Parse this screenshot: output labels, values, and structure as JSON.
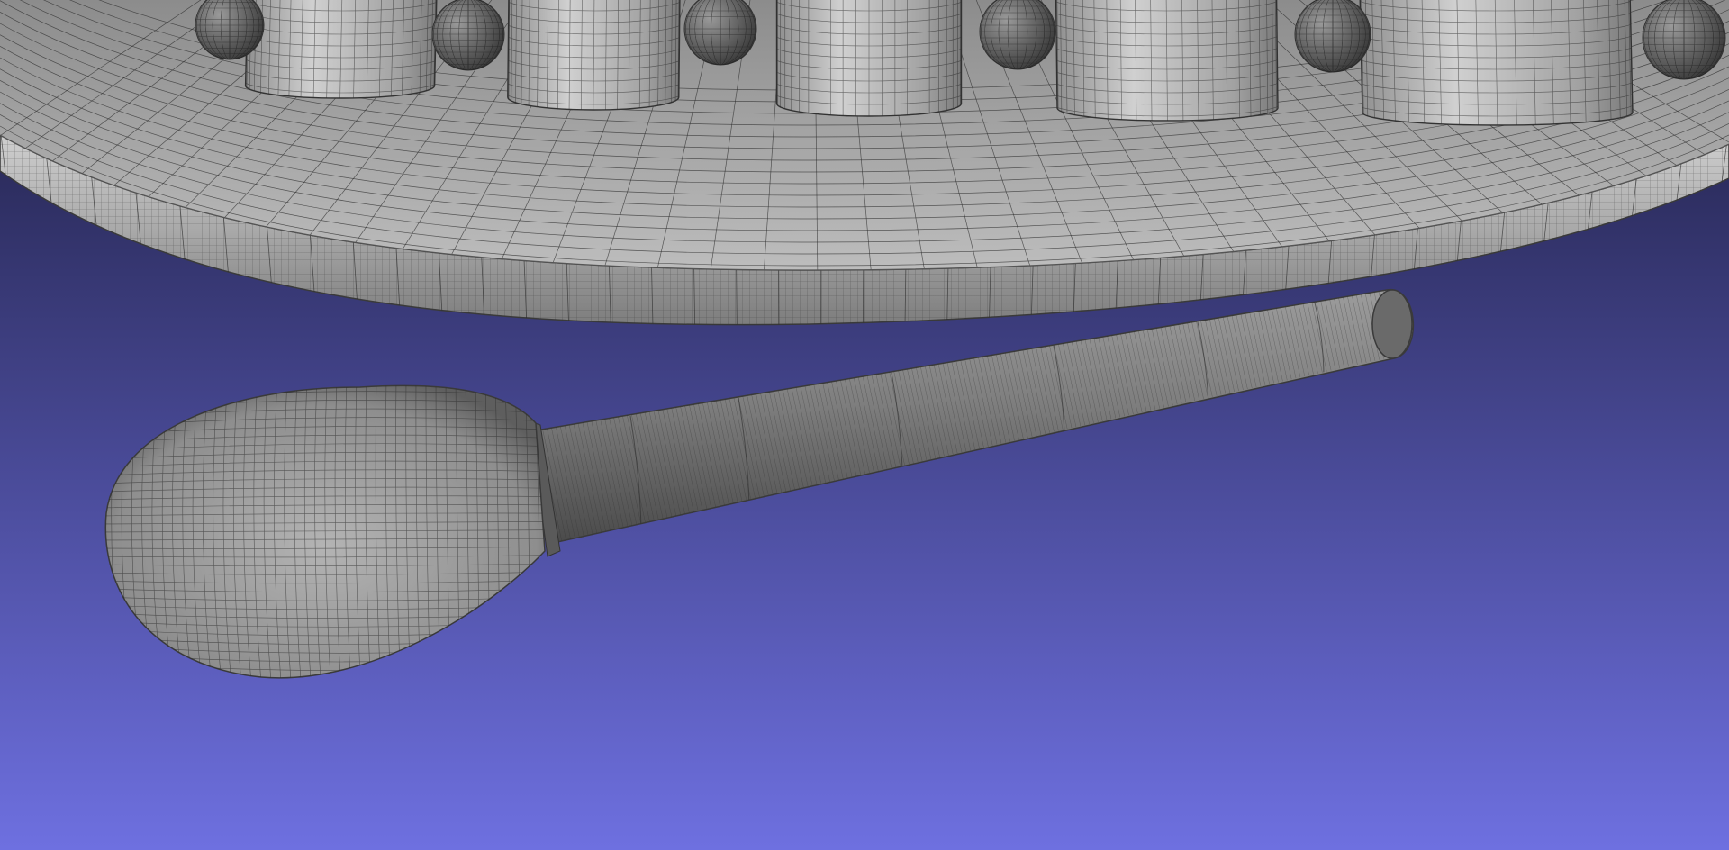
{
  "viewer": {
    "background_top_color": "#1c1c3e",
    "background_bottom_color": "#6e70e0",
    "mesh_fill_color": "#a6a6a6",
    "wire_color": "#2c2c2c"
  },
  "scene": {
    "objects": [
      {
        "name": "platter-mesh",
        "kind": "curved tray with rim"
      },
      {
        "name": "cylinder-mesh",
        "kind": "cylinder",
        "count": 6
      },
      {
        "name": "sphere-mesh",
        "kind": "sphere",
        "count": 6
      },
      {
        "name": "mallet-mesh",
        "kind": "mallet with spherical head and long handle"
      }
    ]
  }
}
